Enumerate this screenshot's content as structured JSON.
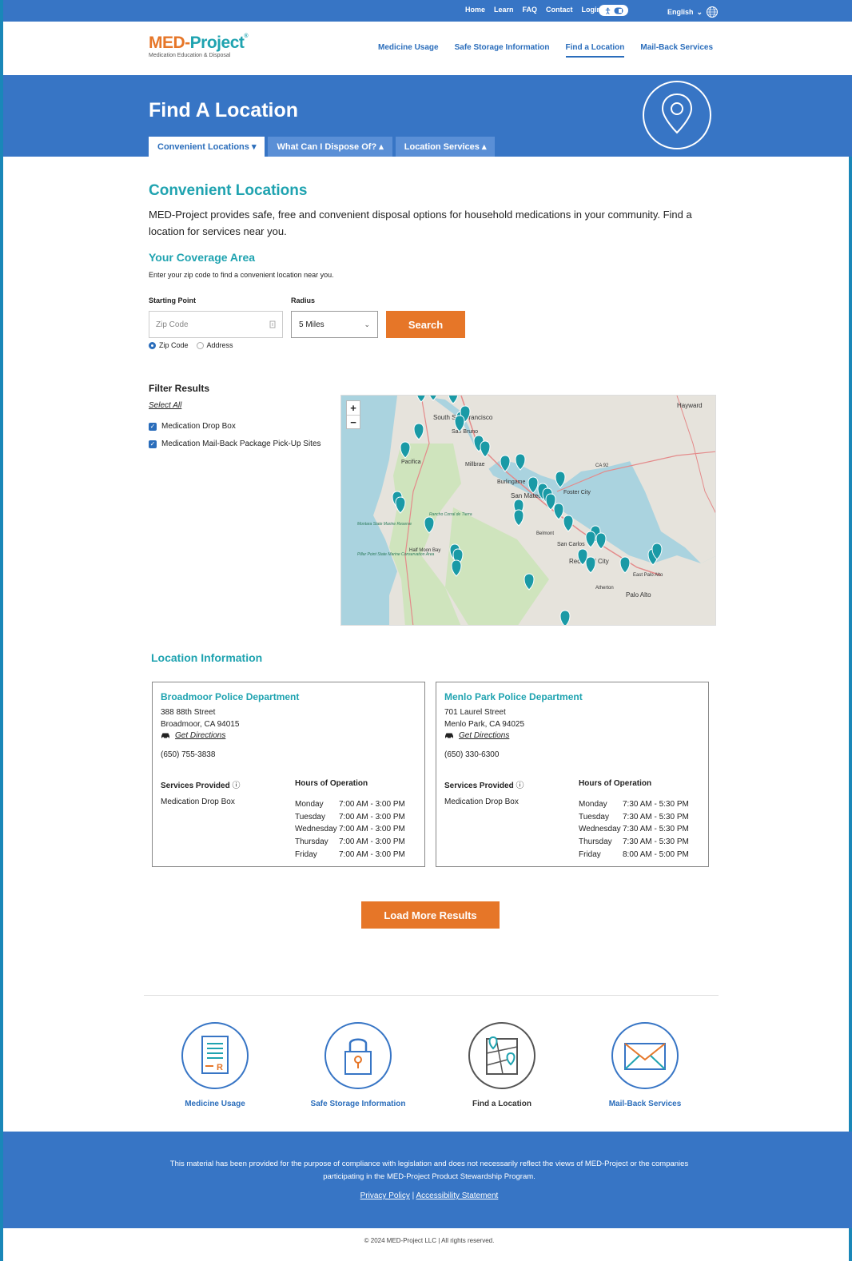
{
  "utility_nav": {
    "links": [
      "Home",
      "Learn",
      "FAQ",
      "Contact",
      "Login"
    ],
    "language": "English"
  },
  "header": {
    "logo_main_part1": "MED-",
    "logo_main_part2": "Project",
    "logo_mark": "®",
    "logo_sub": "Medication Education & Disposal",
    "nav": [
      "Medicine Usage",
      "Safe Storage Information",
      "Find a Location",
      "Mail-Back Services"
    ],
    "active_nav": "Find a Location"
  },
  "hero": {
    "title": "Find A Location",
    "tabs": [
      "Convenient Locations ▾",
      "What Can I Dispose Of? ▴",
      "Location Services ▴"
    ]
  },
  "main": {
    "heading": "Convenient Locations",
    "intro": "MED-Project provides safe, free and convenient disposal options for household medications in your community. Find a location for services near you.",
    "coverage_heading": "Your Coverage Area",
    "coverage_hint": "Enter your zip code to find a convenient location near you.",
    "starting_point_label": "Starting Point",
    "radius_label": "Radius",
    "zip_placeholder": "Zip Code",
    "radius_value": "5 Miles",
    "search_label": "Search",
    "radio_zip": "Zip Code",
    "radio_address": "Address",
    "selected_radio": "Zip Code"
  },
  "filters": {
    "heading": "Filter Results",
    "select_all": "Select All",
    "options": [
      "Medication Drop Box",
      "Medication Mail-Back Package Pick-Up Sites"
    ]
  },
  "map": {
    "zoom_in": "+",
    "zoom_out": "−",
    "place_labels": [
      "South San Francisco",
      "San Bruno",
      "Millbrae",
      "Burlingame",
      "San Mateo",
      "Foster City",
      "Belmont",
      "San Carlos",
      "Redwood City",
      "Atherton",
      "Palo Alto",
      "East Palo Alto",
      "Hayward",
      "Pacifica",
      "Half Moon Bay",
      "Montara State Marine Reserve",
      "Pillar Point State Marine Conservation Area",
      "Rancho Corral de Tierra",
      "CA 92"
    ],
    "land_color": "#e6e3dc",
    "water_color": "#aad3df",
    "park_color": "#cfe4bd",
    "marker_color": "#1a9aa6"
  },
  "locations": {
    "heading": "Location Information",
    "services_label": "Services Provided",
    "hours_label": "Hours of Operation",
    "directions_label": "Get Directions",
    "cards": [
      {
        "name": "Broadmoor Police Department",
        "street": "388 88th Street",
        "city": "Broadmoor, CA 94015",
        "phone": "(650) 755-3838",
        "service": "Medication Drop Box",
        "hours": [
          {
            "day": "Monday",
            "time": "7:00 AM - 3:00 PM"
          },
          {
            "day": "Tuesday",
            "time": "7:00 AM - 3:00 PM"
          },
          {
            "day": "Wednesday",
            "time": "7:00 AM - 3:00 PM"
          },
          {
            "day": "Thursday",
            "time": "7:00 AM - 3:00 PM"
          },
          {
            "day": "Friday",
            "time": "7:00 AM - 3:00 PM"
          }
        ]
      },
      {
        "name": "Menlo Park Police Department",
        "street": "701 Laurel Street",
        "city": "Menlo Park, CA 94025",
        "phone": "(650) 330-6300",
        "service": "Medication Drop Box",
        "hours": [
          {
            "day": "Monday",
            "time": "7:30 AM - 5:30 PM"
          },
          {
            "day": "Tuesday",
            "time": "7:30 AM - 5:30 PM"
          },
          {
            "day": "Wednesday",
            "time": "7:30 AM - 5:30 PM"
          },
          {
            "day": "Thursday",
            "time": "7:30 AM - 5:30 PM"
          },
          {
            "day": "Friday",
            "time": "8:00 AM - 5:00 PM"
          }
        ]
      }
    ],
    "load_more": "Load More Results"
  },
  "quick_links": [
    {
      "label": "Medicine Usage",
      "icon": "medicine-document-icon"
    },
    {
      "label": "Safe Storage Information",
      "icon": "padlock-icon"
    },
    {
      "label": "Find a Location",
      "icon": "map-pin-icon"
    },
    {
      "label": "Mail-Back Services",
      "icon": "envelope-icon"
    }
  ],
  "footer": {
    "disclaimer": "This material has been provided for the purpose of compliance with legislation and does not necessarily reflect the views of MED-Project or the companies participating in the MED-Project Product Stewardship Program.",
    "privacy": "Privacy Policy",
    "separator": "|",
    "accessibility": "Accessibility Statement",
    "copyright": "© 2024 MED-Project LLC | All rights reserved."
  },
  "colors": {
    "brand_blue": "#3775c5",
    "teal": "#1fa3b0",
    "orange": "#e67628"
  }
}
